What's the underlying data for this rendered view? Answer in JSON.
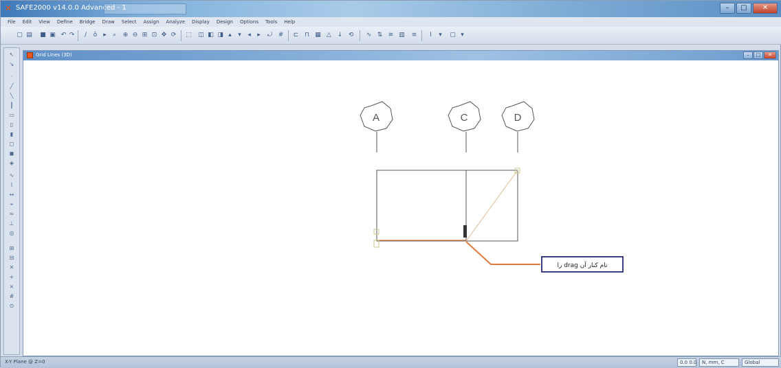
{
  "window": {
    "title": "SAFE2000 v14.0.0 Advanced - 1",
    "app_icon": "x-logo-icon"
  },
  "menu": [
    "File",
    "Edit",
    "View",
    "Define",
    "Bridge",
    "Draw",
    "Select",
    "Assign",
    "Analyze",
    "Display",
    "Design",
    "Options",
    "Tools",
    "Help"
  ],
  "document": {
    "title": "Grid Lines (3D)"
  },
  "drawing": {
    "grid_labels": [
      "A",
      "C",
      "D"
    ],
    "callout_text": "نام کنار آن drag را",
    "accent_color": "#e07a3a",
    "callout_border": "#3a3c8c"
  },
  "status": {
    "left": "X-Y Plane @ Z=0",
    "units": "N, mm, C",
    "coord": "Global",
    "extra": "0.0  0.0"
  }
}
